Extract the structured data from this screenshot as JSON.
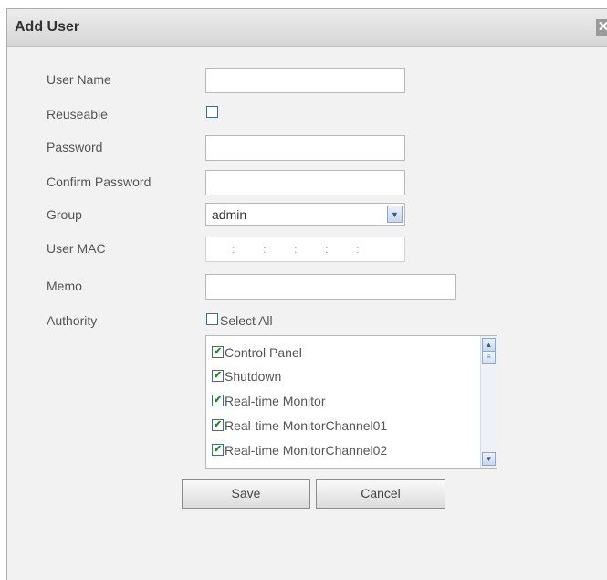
{
  "dialog": {
    "title": "Add User",
    "close_glyph": "✕"
  },
  "form": {
    "user_name": {
      "label": "User Name",
      "value": ""
    },
    "reuseable": {
      "label": "Reuseable",
      "checked": false
    },
    "password": {
      "label": "Password",
      "value": ""
    },
    "confirm_password": {
      "label": "Confirm Password",
      "value": ""
    },
    "group": {
      "label": "Group",
      "selected": "admin"
    },
    "user_mac": {
      "label": "User MAC",
      "separators": [
        ":",
        ":",
        ":",
        ":",
        ":"
      ]
    },
    "memo": {
      "label": "Memo",
      "value": ""
    },
    "authority": {
      "label": "Authority",
      "select_all_label": "Select All",
      "select_all_checked": false,
      "items": [
        {
          "label": "Control Panel",
          "checked": true
        },
        {
          "label": "Shutdown",
          "checked": true
        },
        {
          "label": "Real-time Monitor",
          "checked": true
        },
        {
          "label": "Real-time MonitorChannel01",
          "checked": true
        },
        {
          "label": "Real-time MonitorChannel02",
          "checked": true
        }
      ]
    }
  },
  "buttons": {
    "save": "Save",
    "cancel": "Cancel"
  },
  "icons": {
    "check": "✔",
    "dropdown": "▼",
    "scroll_up": "▲",
    "scroll_down": "▼",
    "scroll_thumb": "≡"
  },
  "colors": {
    "checkbox_border": "#486a92",
    "check_mark": "#1c8b1c",
    "scroll_accent": "#8fa6c6"
  }
}
